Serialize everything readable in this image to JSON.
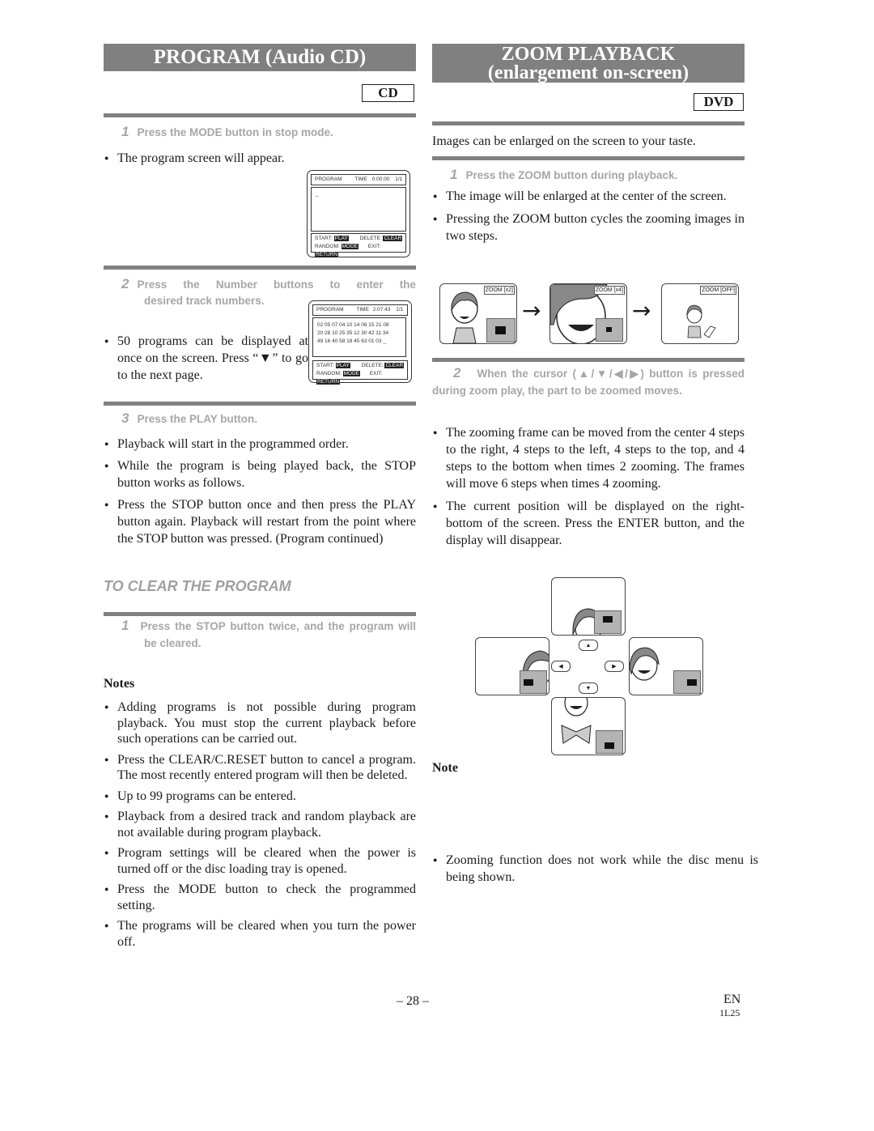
{
  "left": {
    "banner": "PROGRAM (Audio CD)",
    "badge": "CD",
    "step1": {
      "num": "1",
      "text": "Press the MODE button in stop mode."
    },
    "step1_bullet": "The program screen will appear.",
    "screen1": {
      "header": "PROGRAM",
      "time_label": "TIME",
      "time": "0:00:00",
      "page": "1/1",
      "cursor": "_",
      "start_label": "START:",
      "start_key": "PLAY",
      "delete_label": "DELETE:",
      "delete_key": "CLEAR",
      "random_label": "RANDOM:",
      "random_key": "MODE",
      "exit_label": "EXIT:",
      "exit_key": "RETURN"
    },
    "step2": {
      "num": "2",
      "line1": "Press the Number buttons to enter the",
      "line2": "desired track numbers."
    },
    "step2_bullet": "50 programs can be displayed at once on the screen. Press “▼” to go to the next page.",
    "screen2": {
      "header": "PROGRAM",
      "time_label": "TIME",
      "time": "2:07:43",
      "page": "1/1",
      "rows": [
        "02 05 07 04 10 14 06 15 21 08",
        "20 28 10 25 35 12 30 42 11 34",
        "49 16 40 58 18 45 63 01 03 _"
      ],
      "start_label": "START:",
      "start_key": "PLAY",
      "delete_label": "DELETE:",
      "delete_key": "CLEAR",
      "random_label": "RANDOM:",
      "random_key": "MODE",
      "exit_label": "EXIT:",
      "exit_key": "RETURN"
    },
    "step3": {
      "num": "3",
      "text": "Press the PLAY button."
    },
    "step3_bullets": [
      "Playback will start in the programmed order.",
      "While the program is being played back, the STOP button works as follows.",
      "Press the STOP button once and then press the PLAY button again. Playback will restart from the point where the STOP button was pressed. (Program continued)"
    ],
    "clear_heading": "TO CLEAR THE PROGRAM",
    "clear_step": {
      "num": "1",
      "text": "Press the STOP button twice, and the program will be cleared."
    },
    "notes_heading": "Notes",
    "notes": [
      "Adding programs is not possible during program playback. You must stop the current playback before such operations can be carried out.",
      "Press the CLEAR/C.RESET button to cancel a program. The most recently entered program will then be deleted.",
      "Up to 99 programs can be entered.",
      "Playback from a desired track and random playback are not available during program playback.",
      "Program settings will be cleared when the power is turned off or the disc loading tray is opened.",
      "Press the MODE button to check the programmed setting.",
      "The programs will be cleared when you turn the power off."
    ]
  },
  "right": {
    "banner_line1": "ZOOM PLAYBACK",
    "banner_line2": "(enlargement on-screen)",
    "badge": "DVD",
    "intro": "Images can be enlarged on the screen to your taste.",
    "step1": {
      "num": "1",
      "text": "Press the ZOOM button during playback."
    },
    "step1_bullets": [
      "The image will be enlarged at the center of the screen.",
      "Pressing the ZOOM button cycles the zooming images in two steps."
    ],
    "zoom_labels": [
      "ZOOM [x2]",
      "ZOOM [x4]",
      "ZOOM [OFF]"
    ],
    "arrow_glyph": "→",
    "step2": {
      "num": "2",
      "text": "When the cursor (▲/▼/◀/▶) button is pressed during zoom play, the part to be zoomed moves."
    },
    "step2_bullets": [
      "The zooming frame can be moved from the center 4 steps to the right, 4 steps to the left, 4 steps to the top, and 4 steps to the bottom when times 2 zooming. The frames will move 6 steps when times 4 zooming.",
      "The current position will be displayed on the right-bottom of the screen. Press the ENTER button, and the display will disappear."
    ],
    "cursor_buttons": {
      "up": "▲",
      "down": "▼",
      "left": "◀",
      "right": "▶"
    },
    "note_heading": "Note",
    "notes": [
      "Zooming function does not work while the disc menu is being shown."
    ]
  },
  "footer": {
    "page_number": "– 28 –",
    "lang": "EN",
    "code": "1L25"
  }
}
